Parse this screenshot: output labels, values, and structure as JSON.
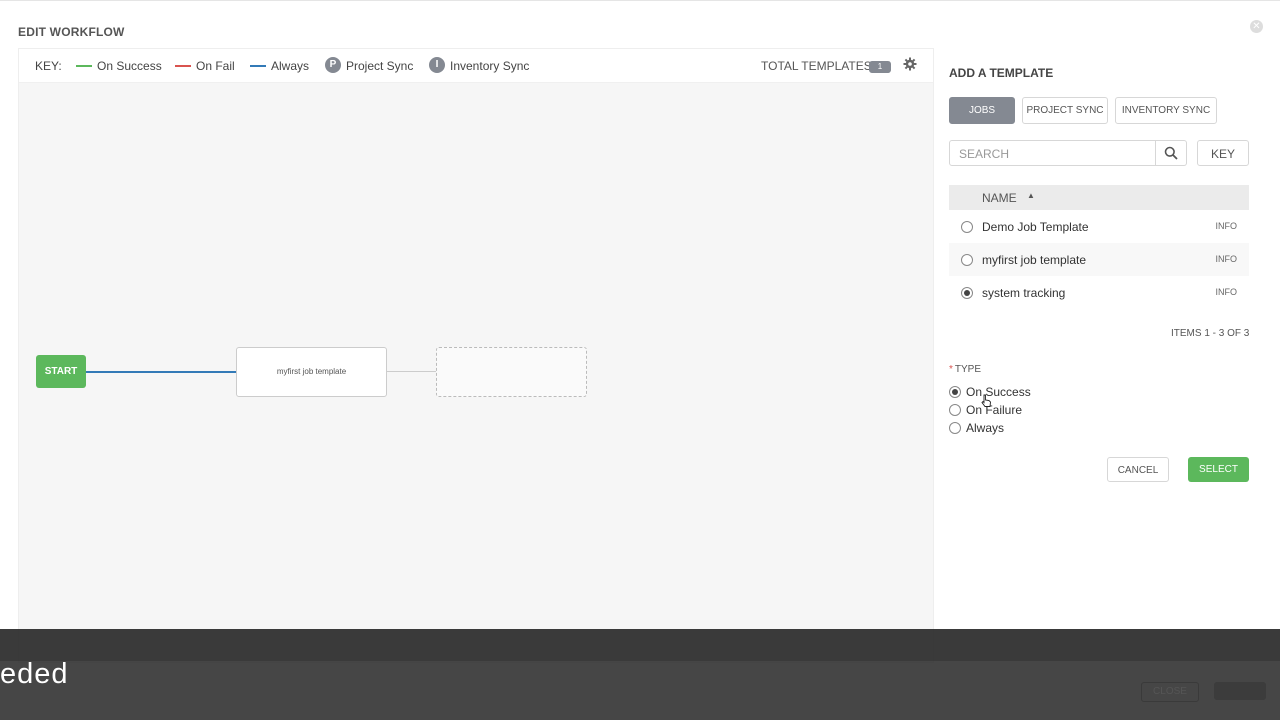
{
  "window": {
    "title": "EDIT WORKFLOW"
  },
  "key_bar": {
    "key_label": "KEY:",
    "on_success": "On Success",
    "on_fail": "On Fail",
    "always": "Always",
    "project_sync_glyph": "P",
    "project_sync": "Project Sync",
    "inventory_sync_glyph": "I",
    "inventory_sync": "Inventory Sync",
    "total_templates": "TOTAL TEMPLATES",
    "total_count": "1"
  },
  "canvas": {
    "start_label": "START",
    "node_label": "myfirst job template"
  },
  "panel": {
    "title": "ADD A TEMPLATE",
    "tabs": [
      "JOBS",
      "PROJECT SYNC",
      "INVENTORY SYNC"
    ],
    "search_placeholder": "SEARCH",
    "key_button": "KEY",
    "column_name": "NAME",
    "rows": [
      {
        "name": "Demo Job Template",
        "info": "INFO",
        "selected": false
      },
      {
        "name": "myfirst job template",
        "info": "INFO",
        "selected": false
      },
      {
        "name": "system tracking",
        "info": "INFO",
        "selected": true
      }
    ],
    "items_count": "ITEMS  1 - 3 OF 3",
    "type_required_mark": "*",
    "type_label": "TYPE",
    "type_options": [
      "On Success",
      "On Failure",
      "Always"
    ],
    "type_selected": "On Success",
    "cancel": "CANCEL",
    "select": "SELECT"
  },
  "overlay": {
    "caption": "eded",
    "close": "CLOSE"
  },
  "colors": {
    "success": "#5cb85c",
    "fail": "#d9534f",
    "always": "#337ab7",
    "badge": "#848992"
  }
}
